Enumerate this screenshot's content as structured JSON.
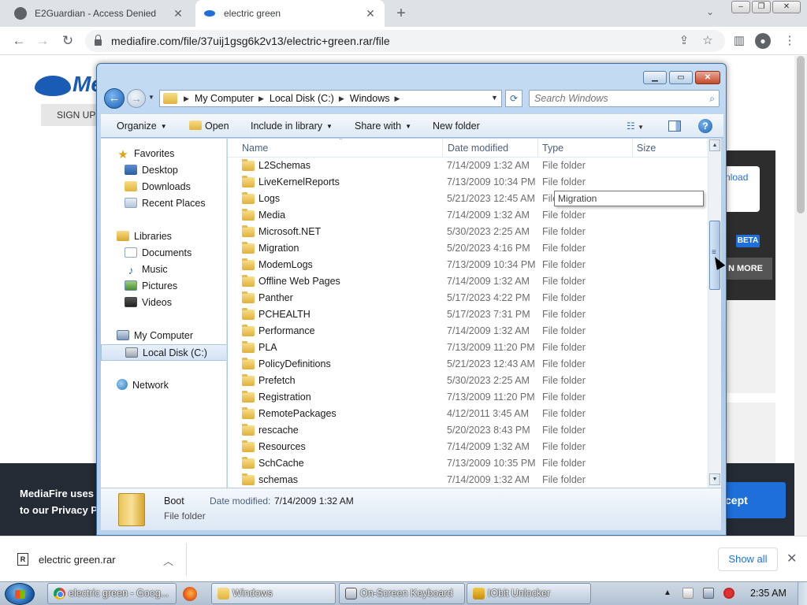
{
  "browser": {
    "tabs": [
      {
        "title": "E2Guardian - Access Denied",
        "active": false,
        "icon": "globe-icon"
      },
      {
        "title": "electric green",
        "active": true,
        "icon": "mediafire-icon"
      }
    ],
    "url": "mediafire.com/file/37uij1gsg6k2v13/electric+green.rar/file"
  },
  "page": {
    "logo_text": "Me",
    "signup_label": "SIGN UP",
    "download_fragment": "nload",
    "beta_badge": "BETA",
    "learn_more_fragment": "N MORE",
    "cookie_text_line1": "MediaFire uses c",
    "cookie_text_line2": "to our Privacy Po",
    "accept_fragment": "cept"
  },
  "explorer": {
    "breadcrumb": [
      "My Computer",
      "Local Disk (C:)",
      "Windows"
    ],
    "search_placeholder": "Search Windows",
    "commands": {
      "organize": "Organize",
      "open": "Open",
      "include_in_library": "Include in library",
      "share_with": "Share with",
      "new_folder": "New folder"
    },
    "nav": {
      "favorites_header": "Favorites",
      "favorites": [
        "Desktop",
        "Downloads",
        "Recent Places"
      ],
      "libraries_header": "Libraries",
      "libraries": [
        "Documents",
        "Music",
        "Pictures",
        "Videos"
      ],
      "computer_header": "My Computer",
      "computer_items": [
        "Local Disk (C:)"
      ],
      "network_header": "Network",
      "selected": "Local Disk (C:)"
    },
    "columns": {
      "name": "Name",
      "date_modified": "Date modified",
      "type": "Type",
      "size": "Size"
    },
    "files": [
      {
        "name": "L2Schemas",
        "date": "7/14/2009 1:32 AM",
        "type": "File folder"
      },
      {
        "name": "LiveKernelReports",
        "date": "7/13/2009 10:34 PM",
        "type": "File folder"
      },
      {
        "name": "Logs",
        "date": "5/21/2023 12:45 AM",
        "type": "File folder"
      },
      {
        "name": "Media",
        "date": "7/14/2009 1:32 AM",
        "type": "File folder"
      },
      {
        "name": "Microsoft.NET",
        "date": "5/30/2023 2:25 AM",
        "type": "File folder"
      },
      {
        "name": "Migration",
        "date": "5/20/2023 4:16 PM",
        "type": "File folder"
      },
      {
        "name": "ModemLogs",
        "date": "7/13/2009 10:34 PM",
        "type": "File folder"
      },
      {
        "name": "Offline Web Pages",
        "date": "7/14/2009 1:32 AM",
        "type": "File folder"
      },
      {
        "name": "Panther",
        "date": "5/17/2023 4:22 PM",
        "type": "File folder"
      },
      {
        "name": "PCHEALTH",
        "date": "5/17/2023 7:31 PM",
        "type": "File folder"
      },
      {
        "name": "Performance",
        "date": "7/14/2009 1:32 AM",
        "type": "File folder"
      },
      {
        "name": "PLA",
        "date": "7/13/2009 11:20 PM",
        "type": "File folder"
      },
      {
        "name": "PolicyDefinitions",
        "date": "5/21/2023 12:43 AM",
        "type": "File folder"
      },
      {
        "name": "Prefetch",
        "date": "5/30/2023 2:25 AM",
        "type": "File folder"
      },
      {
        "name": "Registration",
        "date": "7/13/2009 11:20 PM",
        "type": "File folder"
      },
      {
        "name": "RemotePackages",
        "date": "4/12/2011 3:45 AM",
        "type": "File folder"
      },
      {
        "name": "rescache",
        "date": "5/20/2023 8:43 PM",
        "type": "File folder"
      },
      {
        "name": "Resources",
        "date": "7/14/2009 1:32 AM",
        "type": "File folder"
      },
      {
        "name": "SchCache",
        "date": "7/13/2009 10:35 PM",
        "type": "File folder"
      },
      {
        "name": "schemas",
        "date": "7/14/2009 1:32 AM",
        "type": "File folder"
      }
    ],
    "tooltip": "Migration",
    "details": {
      "name": "Boot",
      "date_label": "Date modified:",
      "date_value": "7/14/2009 1:32 AM",
      "type": "File folder"
    }
  },
  "downloads": {
    "file_name": "electric green.rar",
    "show_all": "Show all"
  },
  "taskbar": {
    "tasks": [
      {
        "label": "electric green - Goog...",
        "icon": "chrome-icon"
      },
      {
        "label": "Windows",
        "icon": "folder-icon"
      },
      {
        "label": "On-Screen Keyboard",
        "icon": "keyboard-icon"
      },
      {
        "label": "IObit Unlocker",
        "icon": "iobit-icon"
      }
    ],
    "clock": "2:35 AM"
  }
}
